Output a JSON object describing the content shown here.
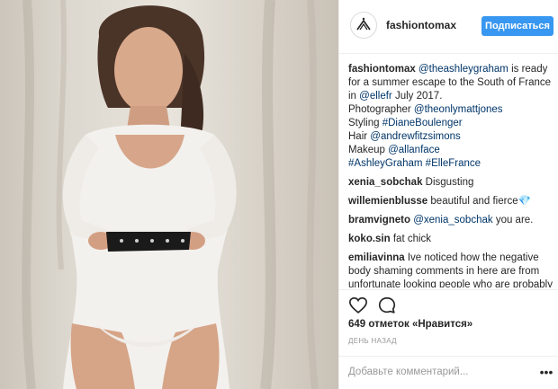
{
  "post": {
    "username": "fashiontomax",
    "follow_label": "Подписаться",
    "photo_alt": "photo"
  },
  "caption": {
    "author": "fashiontomax",
    "mention_1": "@theashleygraham",
    "text_1": " is ready for a summer escape to the South of France in ",
    "mention_2": "@ellefr",
    "text_2": " July 2017.",
    "line_photographer": "Photographer ",
    "mention_3": "@theonlymattjones",
    "line_styling": "Styling ",
    "hashtag_1": "#DianeBoulenger",
    "line_hair": "Hair ",
    "mention_4": "@andrewfitzsimons",
    "line_makeup": "Makeup ",
    "mention_5": "@allanface",
    "hashtag_2": "#AshleyGraham",
    "hashtag_3": "#ElleFrance"
  },
  "comments": [
    {
      "author": "xenia_sobchak",
      "text": "Disgusting"
    },
    {
      "author": "willemienblusse",
      "text": "beautiful and fierce💎"
    },
    {
      "author": "bramvigneto",
      "mention": "@xenia_sobchak",
      "text": " you are."
    },
    {
      "author": "koko.sin",
      "text": "fat chick"
    },
    {
      "author": "emiliavinna",
      "text": "Ive noticed how the negative body shaming comments in here are from unfortunate looking people who are probably unhappy with their lives. Ironic"
    }
  ],
  "likes": "649 отметок «Нравится»",
  "timestamp": "ДЕНЬ НАЗАД",
  "add_comment_placeholder": "Добавьте комментарий...",
  "more_glyph": "•••",
  "icons": {
    "like": "heart-icon",
    "comment": "comment-icon",
    "more": "more-options-icon"
  }
}
